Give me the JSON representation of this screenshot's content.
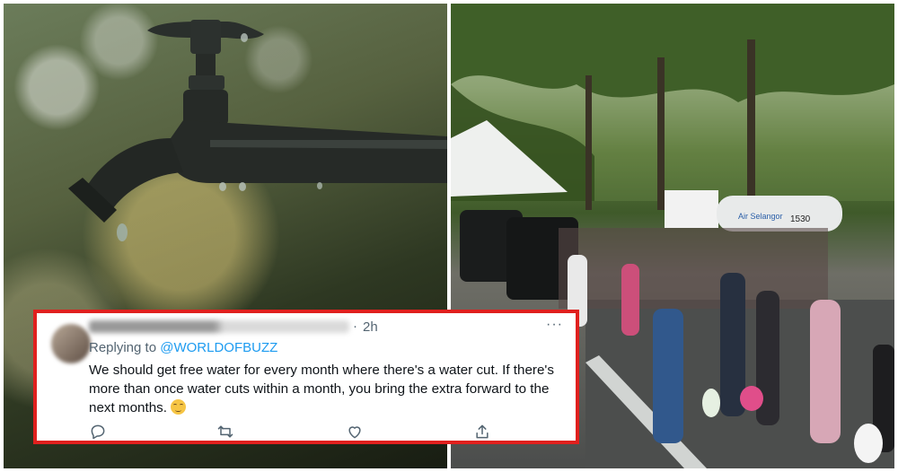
{
  "photos": {
    "left": {
      "subject": "tap-dripping-water"
    },
    "right": {
      "subject": "people-queue-water-tanker",
      "tanker_text": "Air Selangor",
      "tanker_number": "1530"
    }
  },
  "tweet": {
    "separator": "·",
    "time": "2h",
    "more_icon": "···",
    "replying_prefix": "Replying to ",
    "replying_handle": "@WORLDOFBUZZ",
    "text": "We should get free water for every month where there's a water cut. If there's more than once water cuts within a month, you bring the extra forward to the next months.",
    "actions": [
      "reply-icon",
      "retweet-icon",
      "like-icon",
      "share-icon"
    ],
    "border_color": "#e0201e",
    "link_color": "#1d9bf0"
  }
}
